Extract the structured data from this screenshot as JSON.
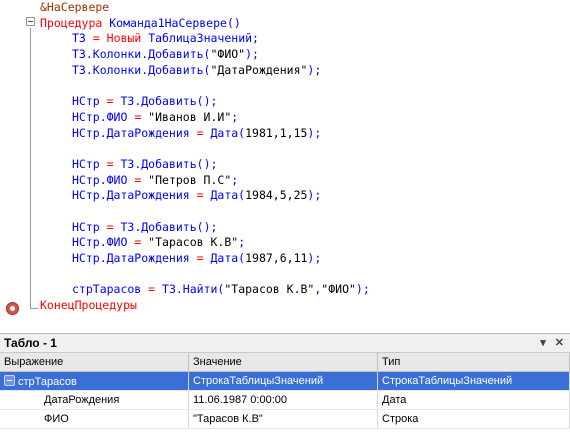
{
  "code": {
    "lines": [
      {
        "type": "pre",
        "text": "&НаСервере"
      },
      {
        "type": "proc",
        "kw": "Процедура",
        "name": "Команда1НаСервере()"
      },
      {
        "type": "assign",
        "lhs": "ТЗ",
        "op": " = ",
        "rhs_kw": "Новый",
        "rhs": " ТаблицаЗначений;"
      },
      {
        "type": "call",
        "text": "ТЗ.Колонки.Добавить(",
        "arg": "\"ФИО\"",
        "tail": ");"
      },
      {
        "type": "call",
        "text": "ТЗ.Колонки.Добавить(",
        "arg": "\"ДатаРождения\"",
        "tail": ");"
      },
      {
        "type": "blank"
      },
      {
        "type": "assign2",
        "lhs": "НСтр",
        "op": " = ",
        "rhs": "ТЗ.Добавить();"
      },
      {
        "type": "field",
        "lhs": "НСтр.ФИО",
        "op": " = ",
        "val": "\"Иванов И.И\"",
        "tail": ";"
      },
      {
        "type": "date",
        "lhs": "НСтр.ДатаРождения",
        "op": " = ",
        "fn": "Дата(",
        "args": "1981,1,15",
        "tail": ");"
      },
      {
        "type": "blank"
      },
      {
        "type": "assign2",
        "lhs": "НСтр",
        "op": " = ",
        "rhs": "ТЗ.Добавить();"
      },
      {
        "type": "field",
        "lhs": "НСтр.ФИО",
        "op": " = ",
        "val": "\"Петров П.С\"",
        "tail": ";"
      },
      {
        "type": "date",
        "lhs": "НСтр.ДатаРождения",
        "op": " = ",
        "fn": "Дата(",
        "args": "1984,5,25",
        "tail": ");"
      },
      {
        "type": "blank"
      },
      {
        "type": "assign2",
        "lhs": "НСтр",
        "op": " = ",
        "rhs": "ТЗ.Добавить();"
      },
      {
        "type": "field",
        "lhs": "НСтр.ФИО",
        "op": " = ",
        "val": "\"Тарасов К.В\"",
        "tail": ";"
      },
      {
        "type": "date",
        "lhs": "НСтр.ДатаРождения",
        "op": " = ",
        "fn": "Дата(",
        "args": "1987,6,11",
        "tail": ");"
      },
      {
        "type": "blank"
      },
      {
        "type": "find",
        "lhs": "стрТарасов",
        "op": " = ",
        "fn": "ТЗ.Найти(",
        "arg1": "\"Тарасов К.В\"",
        "sep": ",",
        "arg2": "\"ФИО\"",
        "tail": ");"
      },
      {
        "type": "end",
        "kw": "КонецПроцедуры"
      }
    ]
  },
  "panel": {
    "title": "Табло - 1",
    "icons": [
      "pin-icon",
      "close-icon"
    ]
  },
  "table": {
    "headers": [
      "Выражение",
      "Значение",
      "Тип"
    ],
    "rows": [
      {
        "expr": "стрТарасов",
        "value": "СтрокаТаблицыЗначений",
        "type": "СтрокаТаблицыЗначений",
        "selected": true,
        "expandable": true
      },
      {
        "expr": "ДатаРождения",
        "value": "11.06.1987 0:00:00",
        "type": "Дата",
        "selected": false,
        "expandable": false
      },
      {
        "expr": "ФИО",
        "value": "\"Тарасов К.В\"",
        "type": "Строка",
        "selected": false,
        "expandable": false
      }
    ]
  }
}
